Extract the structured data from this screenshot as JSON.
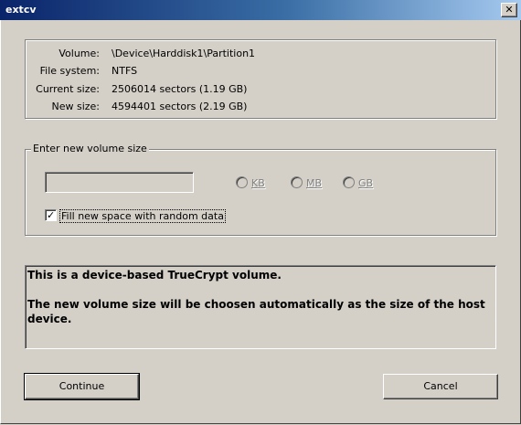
{
  "window": {
    "title": "extcv",
    "close_glyph": "✕"
  },
  "volume_info": {
    "rows": [
      {
        "label": "Volume:",
        "value": "\\Device\\Harddisk1\\Partition1"
      },
      {
        "label": "File system:",
        "value": "NTFS"
      },
      {
        "label": "Current size:",
        "value": "2506014 sectors (1.19 GB)"
      },
      {
        "label": "New size:",
        "value": "4594401 sectors (2.19 GB)"
      }
    ]
  },
  "size_group": {
    "label": "Enter new volume size",
    "size_value": "",
    "units": [
      "KB",
      "MB",
      "GB"
    ],
    "fill_random_label": "Fill new space with random data",
    "fill_random_checked": true
  },
  "message": {
    "line1": "This is a device-based TrueCrypt volume.",
    "line2": "The new volume size will be choosen automatically as the size of the host device."
  },
  "buttons": {
    "continue": "Continue",
    "cancel": "Cancel"
  }
}
